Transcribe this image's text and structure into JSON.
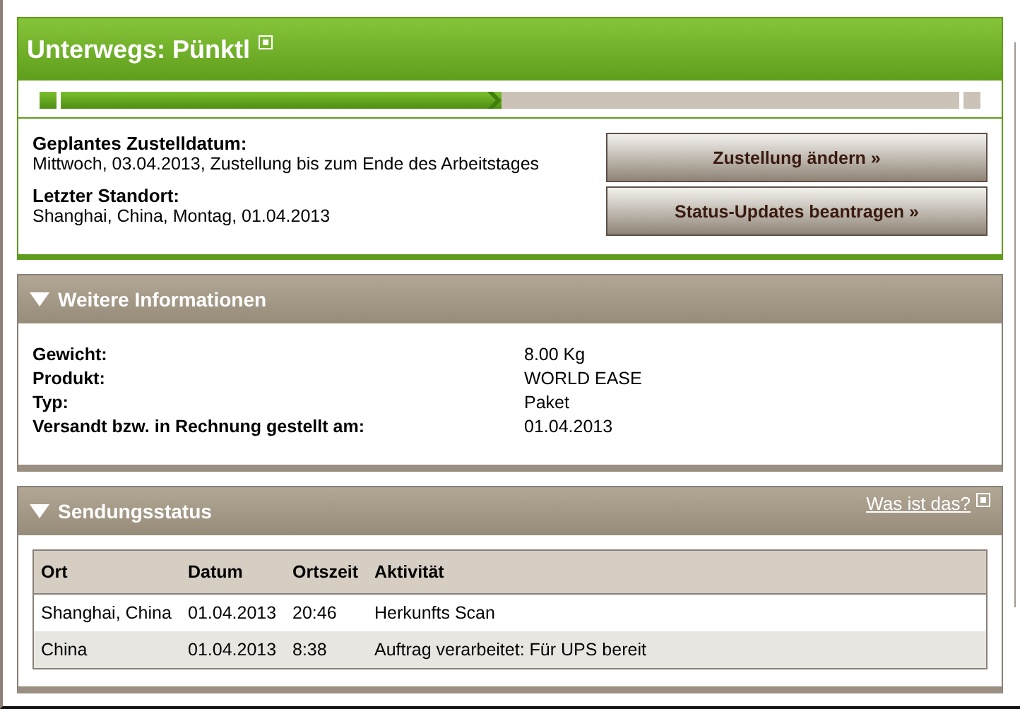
{
  "status_panel": {
    "title": "Unterwegs: Pünktl",
    "help_icon": true,
    "progress": {
      "level": 0.49
    },
    "fields": [
      {
        "label": "Geplantes Zustelldatum:",
        "value": "Mittwoch, 03.04.2013, Zustellung bis zum Ende des Arbeitstages"
      },
      {
        "label": "Letzter Standort:",
        "value": "Shanghai, China, Montag, 01.04.2013"
      }
    ],
    "buttons": [
      "Zustellung ändern »",
      "Status-Updates beantragen »"
    ]
  },
  "info_panel": {
    "title": "Weitere Informationen",
    "expanded": true,
    "rows": [
      {
        "label": "Gewicht:",
        "value": "8.00 Kg"
      },
      {
        "label": "Produkt:",
        "value": "WORLD EASE"
      },
      {
        "label": "Typ:",
        "value": "Paket"
      },
      {
        "label": "Versandt bzw. in Rechnung gestellt am:",
        "value": "01.04.2013"
      }
    ]
  },
  "tracking_panel": {
    "title": "Sendungsstatus",
    "expanded": true,
    "help_link": "Was ist das?",
    "table": {
      "columns": [
        "Ort",
        "Datum",
        "Ortszeit",
        "Aktivität"
      ],
      "rows": [
        [
          "Shanghai, China",
          "01.04.2013",
          "20:46",
          "Herkunfts Scan"
        ],
        [
          "China",
          "01.04.2013",
          "8:38",
          "Auftrag verarbeitet: Für UPS bereit"
        ]
      ]
    }
  }
}
